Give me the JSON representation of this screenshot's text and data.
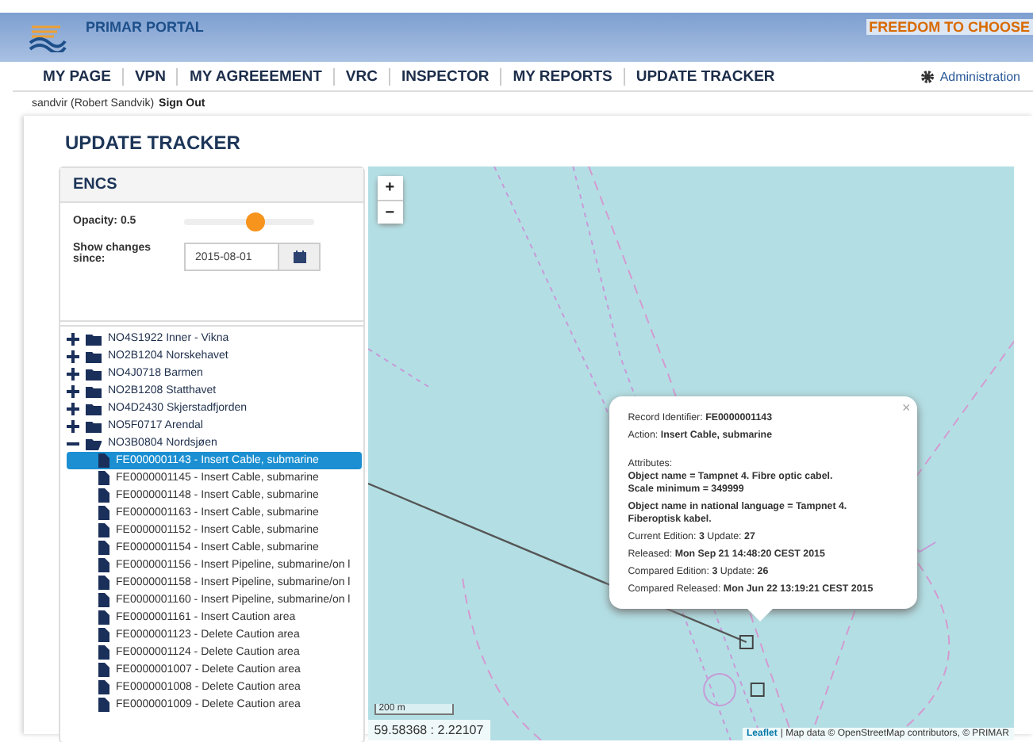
{
  "header": {
    "title": "PRIMAR PORTAL",
    "slogan": "FREEDOM TO CHOOSE"
  },
  "nav": {
    "items": [
      "MY PAGE",
      "VPN",
      "MY AGREEEMENT",
      "VRC",
      "INSPECTOR",
      "MY REPORTS",
      "UPDATE TRACKER"
    ],
    "admin": "Administration"
  },
  "user": {
    "name": "sandvir (Robert Sandvik)",
    "sign_out": "Sign Out"
  },
  "page_title": "UPDATE TRACKER",
  "panel": {
    "title": "ENCS",
    "opacity": {
      "label": "Opacity: 0.5",
      "level": 0.55
    },
    "date": {
      "label": "Show changes since:",
      "value": "2015-08-01"
    },
    "tree": [
      {
        "label": "NO4S1922 Inner - Vikna",
        "expanded": false
      },
      {
        "label": "NO2B1204 Norskehavet",
        "expanded": false
      },
      {
        "label": "NO4J0718 Barmen",
        "expanded": false
      },
      {
        "label": "NO2B1208 Statthavet",
        "expanded": false
      },
      {
        "label": "NO4D2430 Skjerstadfjorden",
        "expanded": false
      },
      {
        "label": "NO5F0717 Arendal",
        "expanded": false
      },
      {
        "label": "NO3B0804 Nordsjøen",
        "expanded": true,
        "children": [
          {
            "label": "FE0000001143 - Insert Cable, submarine",
            "selected": true
          },
          {
            "label": "FE0000001145 - Insert Cable, submarine",
            "selected": false
          },
          {
            "label": "FE0000001148 - Insert Cable, submarine",
            "selected": false
          },
          {
            "label": "FE0000001163 - Insert Cable, submarine",
            "selected": false
          },
          {
            "label": "FE0000001152 - Insert Cable, submarine",
            "selected": false
          },
          {
            "label": "FE0000001154 - Insert Cable, submarine",
            "selected": false
          },
          {
            "label": "FE0000001156 - Insert Pipeline, submarine/on l",
            "selected": false
          },
          {
            "label": "FE0000001158 - Insert Pipeline, submarine/on l",
            "selected": false
          },
          {
            "label": "FE0000001160 - Insert Pipeline, submarine/on l",
            "selected": false
          },
          {
            "label": "FE0000001161 - Insert Caution area",
            "selected": false
          },
          {
            "label": "FE0000001123 - Delete Caution area",
            "selected": false
          },
          {
            "label": "FE0000001124 - Delete Caution area",
            "selected": false
          },
          {
            "label": "FE0000001007 - Delete Caution area",
            "selected": false
          },
          {
            "label": "FE0000001008 - Delete Caution area",
            "selected": false
          },
          {
            "label": "FE0000001009 - Delete Caution area",
            "selected": false
          }
        ]
      }
    ]
  },
  "map": {
    "zoom_in": "+",
    "zoom_out": "−",
    "scale": "200 m",
    "coordinates": "59.58368 : 2.22107",
    "attribution_link": "Leaflet",
    "attribution": "| Map data © OpenStreetMap contributors, © PRIMAR",
    "popup": {
      "close": "×",
      "lines": [
        "Record Identifier: **FE0000001143**",
        "Action: **Insert Cable, submarine**",
        "Attributes:",
        "**Object name = Tampnet 4. Fibre optic cabel.**",
        "**Scale minimum = 349999**",
        "**Object name in national language = Tampnet 4. Fiberoptisk kabel.**",
        "Current Edition: **3** Update: **27**",
        "Released: **Mon Sep 21 14:48:20 CEST 2015**",
        "Compared Edition: **3** Update: **26**",
        "Compared Released: **Mon Jun 22 13:19:21 CEST 2015**"
      ]
    }
  }
}
